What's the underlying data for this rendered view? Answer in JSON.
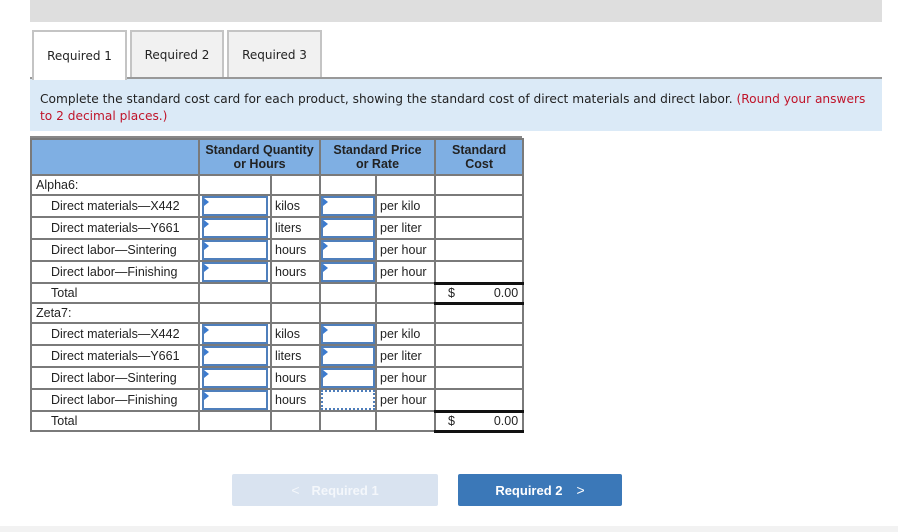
{
  "tabs": [
    {
      "label": "Required 1",
      "active": true
    },
    {
      "label": "Required 2",
      "active": false
    },
    {
      "label": "Required 3",
      "active": false
    }
  ],
  "instruction": {
    "text": "Complete the standard cost card for each product, showing the standard cost of direct materials and direct labor.",
    "note": "(Round your answers to 2 decimal places.)"
  },
  "table": {
    "headers": {
      "label": "",
      "quantity": "Standard Quantity or Hours",
      "price": "Standard Price or Rate",
      "cost": "Standard Cost"
    },
    "products": [
      {
        "name": "Alpha6:",
        "rows": [
          {
            "label": "Direct materials—X442",
            "qty_value": "",
            "unit": "kilos",
            "price_value": "",
            "per": "per kilo",
            "cost": ""
          },
          {
            "label": "Direct materials—Y661",
            "qty_value": "",
            "unit": "liters",
            "price_value": "",
            "per": "per liter",
            "cost": ""
          },
          {
            "label": "Direct labor—Sintering",
            "qty_value": "",
            "unit": "hours",
            "price_value": "",
            "per": "per hour",
            "cost": ""
          },
          {
            "label": "Direct labor—Finishing",
            "qty_value": "",
            "unit": "hours",
            "price_value": "",
            "per": "per hour",
            "cost": ""
          }
        ],
        "total": {
          "label": "Total",
          "currency": "$",
          "value": "0.00"
        }
      },
      {
        "name": "Zeta7:",
        "rows": [
          {
            "label": "Direct materials—X442",
            "qty_value": "",
            "unit": "kilos",
            "price_value": "",
            "per": "per kilo",
            "cost": ""
          },
          {
            "label": "Direct materials—Y661",
            "qty_value": "",
            "unit": "liters",
            "price_value": "",
            "per": "per liter",
            "cost": ""
          },
          {
            "label": "Direct labor—Sintering",
            "qty_value": "",
            "unit": "hours",
            "price_value": "",
            "per": "per hour",
            "cost": ""
          },
          {
            "label": "Direct labor—Finishing",
            "qty_value": "",
            "unit": "hours",
            "price_value": "",
            "per": "per hour",
            "cost": ""
          }
        ],
        "total": {
          "label": "Total",
          "currency": "$",
          "value": "0.00"
        }
      }
    ]
  },
  "navigation": {
    "prev": {
      "label": "Required 1",
      "icon": "chevron-left-icon",
      "glyph": "<",
      "disabled": true
    },
    "next": {
      "label": "Required 2",
      "icon": "chevron-right-icon",
      "glyph": ">",
      "disabled": false
    }
  },
  "colors": {
    "header_bg": "#7fafe3",
    "instruction_bg": "#dbeaf7",
    "note_red": "#c0142a",
    "next_button": "#3b78b8",
    "prev_button_disabled": "#d9e3f0"
  }
}
